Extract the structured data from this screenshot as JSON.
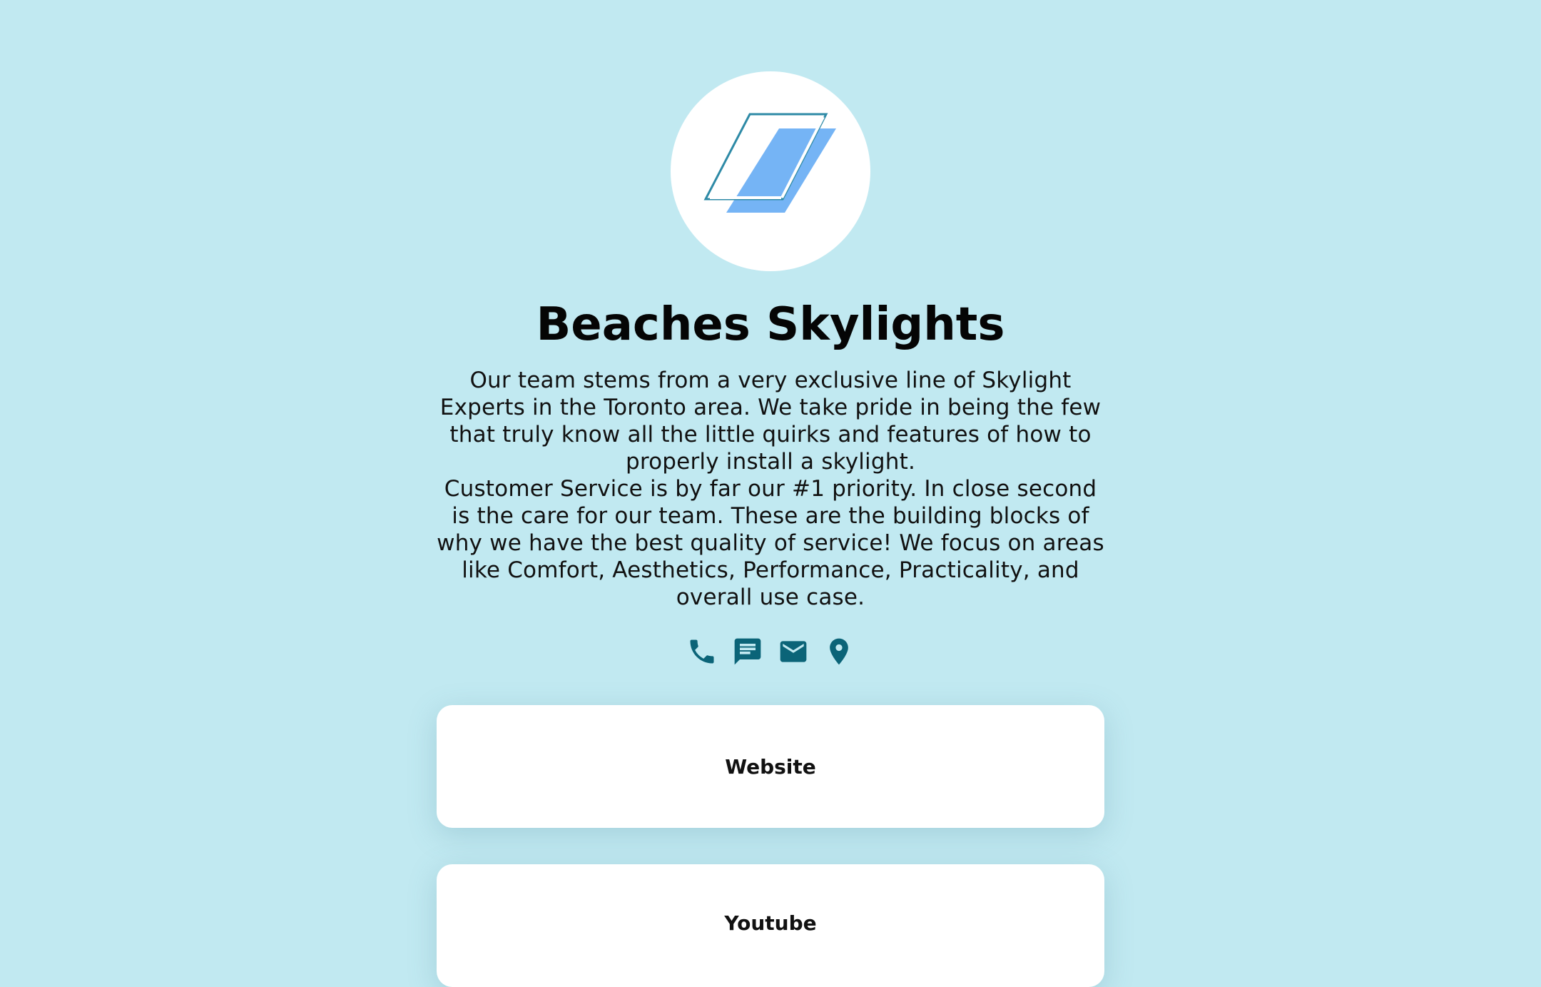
{
  "profile": {
    "name": "Beaches Skylights",
    "description_paragraphs": [
      "Our team stems from a very exclusive line of Skylight Experts in the Toronto area. We take pride in being the few that truly know all the little quirks and features of how to properly install a skylight.",
      "Customer Service is by far our #1 priority. In close second is the care for our team. These are the building blocks of why we have the best quality of service! We focus on areas like Comfort, Aesthetics, Performance, Practicality, and overall use case."
    ]
  },
  "social_icons": [
    "phone-icon",
    "message-icon",
    "email-icon",
    "location-pin-icon"
  ],
  "links": [
    {
      "label": "Website"
    },
    {
      "label": "Youtube"
    }
  ],
  "colors": {
    "background": "#c1e9f1",
    "icon": "#0b6478",
    "logo_fill": "#75b4f5",
    "logo_stroke": "#2e8aa6",
    "card": "#ffffff"
  }
}
